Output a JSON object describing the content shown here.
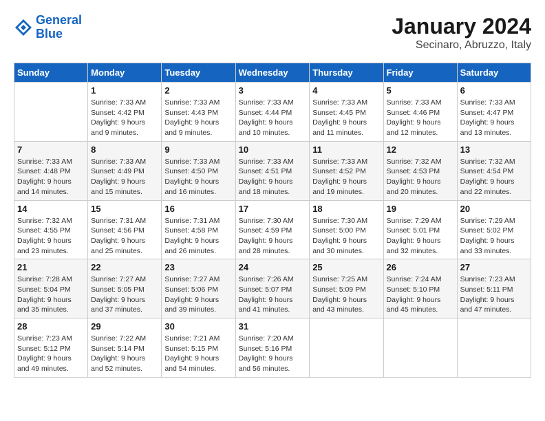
{
  "header": {
    "logo_line1": "General",
    "logo_line2": "Blue",
    "title": "January 2024",
    "subtitle": "Secinaro, Abruzzo, Italy"
  },
  "days_of_week": [
    "Sunday",
    "Monday",
    "Tuesday",
    "Wednesday",
    "Thursday",
    "Friday",
    "Saturday"
  ],
  "weeks": [
    [
      {
        "day": "",
        "info": ""
      },
      {
        "day": "1",
        "info": "Sunrise: 7:33 AM\nSunset: 4:42 PM\nDaylight: 9 hours\nand 9 minutes."
      },
      {
        "day": "2",
        "info": "Sunrise: 7:33 AM\nSunset: 4:43 PM\nDaylight: 9 hours\nand 9 minutes."
      },
      {
        "day": "3",
        "info": "Sunrise: 7:33 AM\nSunset: 4:44 PM\nDaylight: 9 hours\nand 10 minutes."
      },
      {
        "day": "4",
        "info": "Sunrise: 7:33 AM\nSunset: 4:45 PM\nDaylight: 9 hours\nand 11 minutes."
      },
      {
        "day": "5",
        "info": "Sunrise: 7:33 AM\nSunset: 4:46 PM\nDaylight: 9 hours\nand 12 minutes."
      },
      {
        "day": "6",
        "info": "Sunrise: 7:33 AM\nSunset: 4:47 PM\nDaylight: 9 hours\nand 13 minutes."
      }
    ],
    [
      {
        "day": "7",
        "info": "Sunrise: 7:33 AM\nSunset: 4:48 PM\nDaylight: 9 hours\nand 14 minutes."
      },
      {
        "day": "8",
        "info": "Sunrise: 7:33 AM\nSunset: 4:49 PM\nDaylight: 9 hours\nand 15 minutes."
      },
      {
        "day": "9",
        "info": "Sunrise: 7:33 AM\nSunset: 4:50 PM\nDaylight: 9 hours\nand 16 minutes."
      },
      {
        "day": "10",
        "info": "Sunrise: 7:33 AM\nSunset: 4:51 PM\nDaylight: 9 hours\nand 18 minutes."
      },
      {
        "day": "11",
        "info": "Sunrise: 7:33 AM\nSunset: 4:52 PM\nDaylight: 9 hours\nand 19 minutes."
      },
      {
        "day": "12",
        "info": "Sunrise: 7:32 AM\nSunset: 4:53 PM\nDaylight: 9 hours\nand 20 minutes."
      },
      {
        "day": "13",
        "info": "Sunrise: 7:32 AM\nSunset: 4:54 PM\nDaylight: 9 hours\nand 22 minutes."
      }
    ],
    [
      {
        "day": "14",
        "info": "Sunrise: 7:32 AM\nSunset: 4:55 PM\nDaylight: 9 hours\nand 23 minutes."
      },
      {
        "day": "15",
        "info": "Sunrise: 7:31 AM\nSunset: 4:56 PM\nDaylight: 9 hours\nand 25 minutes."
      },
      {
        "day": "16",
        "info": "Sunrise: 7:31 AM\nSunset: 4:58 PM\nDaylight: 9 hours\nand 26 minutes."
      },
      {
        "day": "17",
        "info": "Sunrise: 7:30 AM\nSunset: 4:59 PM\nDaylight: 9 hours\nand 28 minutes."
      },
      {
        "day": "18",
        "info": "Sunrise: 7:30 AM\nSunset: 5:00 PM\nDaylight: 9 hours\nand 30 minutes."
      },
      {
        "day": "19",
        "info": "Sunrise: 7:29 AM\nSunset: 5:01 PM\nDaylight: 9 hours\nand 32 minutes."
      },
      {
        "day": "20",
        "info": "Sunrise: 7:29 AM\nSunset: 5:02 PM\nDaylight: 9 hours\nand 33 minutes."
      }
    ],
    [
      {
        "day": "21",
        "info": "Sunrise: 7:28 AM\nSunset: 5:04 PM\nDaylight: 9 hours\nand 35 minutes."
      },
      {
        "day": "22",
        "info": "Sunrise: 7:27 AM\nSunset: 5:05 PM\nDaylight: 9 hours\nand 37 minutes."
      },
      {
        "day": "23",
        "info": "Sunrise: 7:27 AM\nSunset: 5:06 PM\nDaylight: 9 hours\nand 39 minutes."
      },
      {
        "day": "24",
        "info": "Sunrise: 7:26 AM\nSunset: 5:07 PM\nDaylight: 9 hours\nand 41 minutes."
      },
      {
        "day": "25",
        "info": "Sunrise: 7:25 AM\nSunset: 5:09 PM\nDaylight: 9 hours\nand 43 minutes."
      },
      {
        "day": "26",
        "info": "Sunrise: 7:24 AM\nSunset: 5:10 PM\nDaylight: 9 hours\nand 45 minutes."
      },
      {
        "day": "27",
        "info": "Sunrise: 7:23 AM\nSunset: 5:11 PM\nDaylight: 9 hours\nand 47 minutes."
      }
    ],
    [
      {
        "day": "28",
        "info": "Sunrise: 7:23 AM\nSunset: 5:12 PM\nDaylight: 9 hours\nand 49 minutes."
      },
      {
        "day": "29",
        "info": "Sunrise: 7:22 AM\nSunset: 5:14 PM\nDaylight: 9 hours\nand 52 minutes."
      },
      {
        "day": "30",
        "info": "Sunrise: 7:21 AM\nSunset: 5:15 PM\nDaylight: 9 hours\nand 54 minutes."
      },
      {
        "day": "31",
        "info": "Sunrise: 7:20 AM\nSunset: 5:16 PM\nDaylight: 9 hours\nand 56 minutes."
      },
      {
        "day": "",
        "info": ""
      },
      {
        "day": "",
        "info": ""
      },
      {
        "day": "",
        "info": ""
      }
    ]
  ]
}
